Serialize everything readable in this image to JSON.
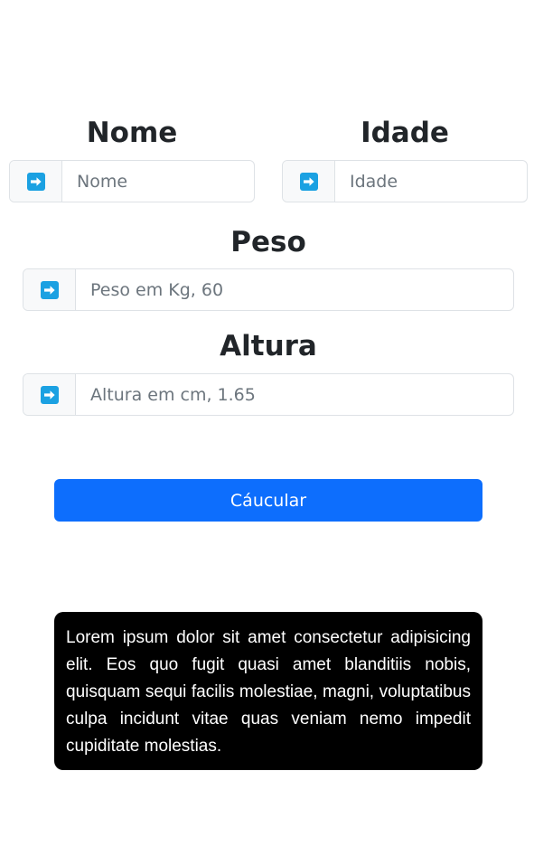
{
  "form": {
    "nome": {
      "label": "Nome",
      "placeholder": "Nome",
      "value": ""
    },
    "idade": {
      "label": "Idade",
      "placeholder": "Idade",
      "value": ""
    },
    "peso": {
      "label": "Peso",
      "placeholder": "Peso em Kg, 60",
      "value": ""
    },
    "altura": {
      "label": "Altura",
      "placeholder": "Altura em cm, 1.65",
      "value": ""
    },
    "addon_icon": "right-arrow-icon"
  },
  "submit_label": "Cáucular",
  "info_text": "Lorem ipsum dolor sit amet consectetur adipisicing elit. Eos quo fugit quasi amet blanditiis nobis, quisquam sequi facilis molestiae, magni, voluptatibus culpa incidunt vitae quas veniam nemo impedit cupiditate molestias.",
  "colors": {
    "primary": "#0d6efd",
    "icon": "#1ba1e2",
    "info_background": "#000000"
  }
}
